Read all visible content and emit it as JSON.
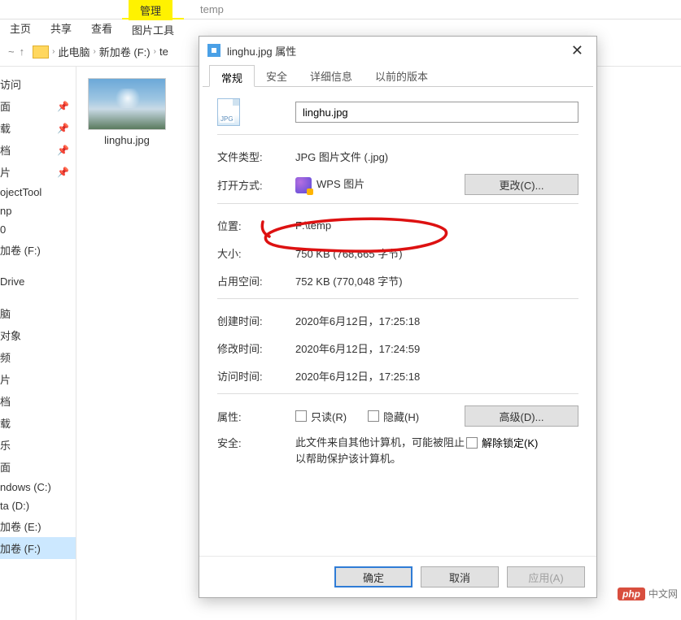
{
  "ribbon": {
    "tabs": [
      "主页",
      "共享",
      "查看"
    ],
    "context_tab": "管理",
    "context_group": "图片工具"
  },
  "toolbar_temp": "temp",
  "breadcrumb": {
    "items": [
      "此电脑",
      "新加卷 (F:)",
      "te"
    ]
  },
  "sidebar": {
    "items": [
      {
        "label": "访问",
        "pin": false
      },
      {
        "label": "面",
        "pin": true
      },
      {
        "label": "载",
        "pin": true
      },
      {
        "label": "档",
        "pin": true
      },
      {
        "label": "片",
        "pin": true
      },
      {
        "label": "ojectTool",
        "pin": false
      },
      {
        "label": "np",
        "pin": false
      },
      {
        "label": "0",
        "pin": false
      },
      {
        "label": "加卷 (F:)",
        "pin": false
      },
      {
        "label": "Drive",
        "pin": false,
        "spaced": true
      },
      {
        "label": "脑",
        "pin": false,
        "spaced": true
      },
      {
        "label": "对象",
        "pin": false
      },
      {
        "label": "频",
        "pin": false
      },
      {
        "label": "片",
        "pin": false
      },
      {
        "label": "档",
        "pin": false
      },
      {
        "label": "载",
        "pin": false
      },
      {
        "label": "乐",
        "pin": false
      },
      {
        "label": "面",
        "pin": false
      },
      {
        "label": "ndows (C:)",
        "pin": false
      },
      {
        "label": "ta (D:)",
        "pin": false
      },
      {
        "label": "加卷 (E:)",
        "pin": false
      },
      {
        "label": "加卷 (F:)",
        "pin": false,
        "selected": true
      }
    ]
  },
  "file": {
    "name": "linghu.jpg"
  },
  "dialog": {
    "title": "linghu.jpg 属性",
    "tabs": [
      "常规",
      "安全",
      "详细信息",
      "以前的版本"
    ],
    "filename": "linghu.jpg",
    "icon_tag": "JPG",
    "labels": {
      "filetype": "文件类型:",
      "openwith": "打开方式:",
      "location": "位置:",
      "size": "大小:",
      "sizeondisk": "占用空间:",
      "created": "创建时间:",
      "modified": "修改时间:",
      "accessed": "访问时间:",
      "attributes": "属性:",
      "security": "安全:"
    },
    "values": {
      "filetype": "JPG 图片文件 (.jpg)",
      "openwith": "WPS 图片",
      "location": "F:\\temp",
      "size": "750 KB (768,665 字节)",
      "sizeondisk": "752 KB (770,048 字节)",
      "created": "2020年6月12日，17:25:18",
      "modified": "2020年6月12日，17:24:59",
      "accessed": "2020年6月12日，17:25:18",
      "security": "此文件来自其他计算机，可能被阻止以帮助保护该计算机。"
    },
    "buttons": {
      "change": "更改(C)...",
      "advanced": "高级(D)...",
      "readonly": "只读(R)",
      "hidden": "隐藏(H)",
      "unblock": "解除锁定(K)",
      "ok": "确定",
      "cancel": "取消",
      "apply": "应用(A)"
    }
  },
  "watermark": {
    "logo": "php",
    "text": "中文网"
  }
}
